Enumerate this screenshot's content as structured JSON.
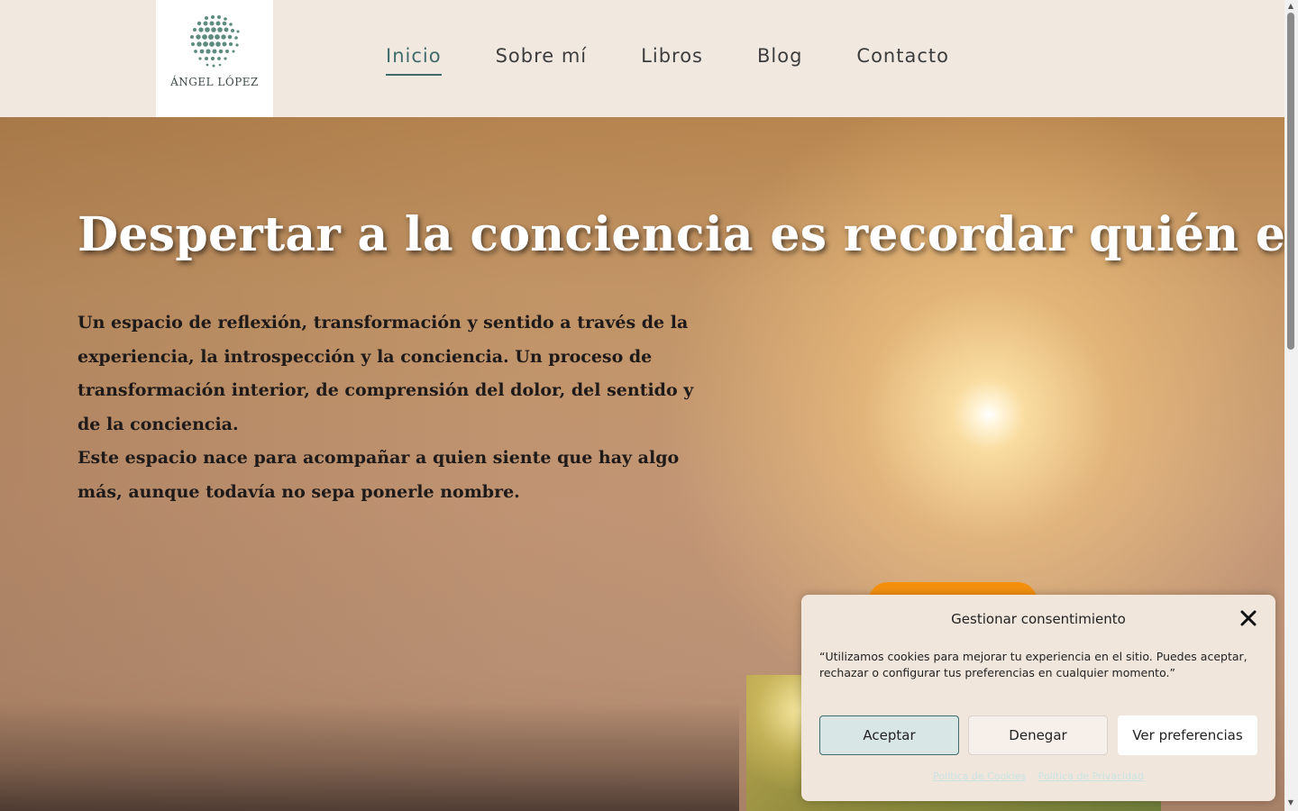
{
  "header": {
    "logo_text": "ÁNGEL LÓPEZ",
    "nav": [
      {
        "label": "Inicio",
        "active": true
      },
      {
        "label": "Sobre mí"
      },
      {
        "label": "Libros"
      },
      {
        "label": "Blog"
      },
      {
        "label": "Contacto"
      }
    ]
  },
  "hero": {
    "title": "Despertar a la conciencia es recordar quién eres",
    "paragraph1": "Un espacio de reflexión, transformación y sentido a través de la experiencia, la introspección y la conciencia. Un proceso de transformación interior, de comprensión del dolor, del sentido y de la conciencia.",
    "paragraph2": "Este espacio nace para acompañar a quien siente que hay algo más, aunque todavía no sepa ponerle nombre."
  },
  "cookie_banner": {
    "title": "Gestionar consentimiento",
    "text": "“Utilizamos cookies para mejorar tu experiencia en el sitio. Puedes aceptar, rechazar o configurar tus preferencias en cualquier momento.”",
    "accept_label": "Aceptar",
    "deny_label": "Denegar",
    "preferences_label": "Ver preferencias",
    "link_cookies": "Política de Cookies",
    "link_privacy": "Política de Privacidad"
  },
  "colors": {
    "accent": "#3f6b6b",
    "header_bg": "#f1e9e0",
    "cta_orange": "#f5900f"
  }
}
